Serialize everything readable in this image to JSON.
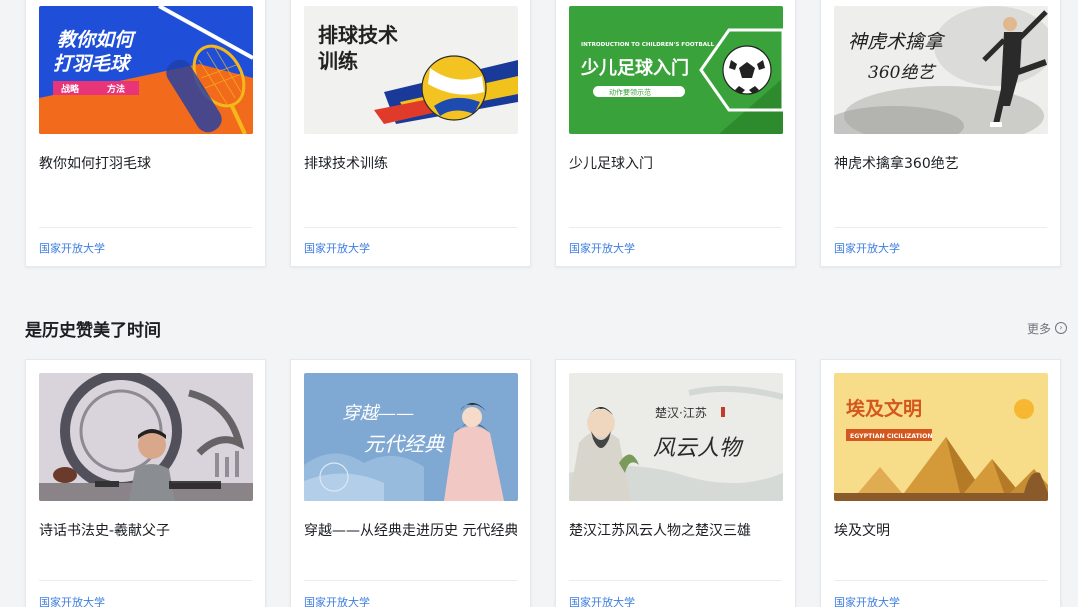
{
  "top_courses": [
    {
      "title": "教你如何打羽毛球",
      "provider": "国家开放大学",
      "thumb_lines": [
        "教你如何",
        "打羽毛球"
      ],
      "thumb_tags": [
        "战略",
        "方法"
      ]
    },
    {
      "title": "排球技术训练",
      "provider": "国家开放大学",
      "thumb_lines": [
        "排球技术",
        "训练"
      ]
    },
    {
      "title": "少儿足球入门",
      "provider": "国家开放大学",
      "thumb_caption": "INTRODUCTION TO CHILDREN'S FOOTBALL",
      "thumb_lines": [
        "少儿足球入门"
      ],
      "thumb_sub": "动作要领示范"
    },
    {
      "title": "神虎术擒拿360绝艺",
      "provider": "国家开放大学",
      "thumb_lines": [
        "神虎术擒拿",
        "360绝艺"
      ]
    }
  ],
  "section": {
    "title": "是历史赞美了时间",
    "more_label": "更多"
  },
  "bottom_courses": [
    {
      "title": "诗话书法史-羲献父子",
      "provider": "国家开放大学"
    },
    {
      "title": "穿越——从经典走进历史 元代经典",
      "provider": "国家开放大学",
      "thumb_lines": [
        "穿越——",
        "元代经典"
      ]
    },
    {
      "title": "楚汉江苏风云人物之楚汉三雄",
      "provider": "国家开放大学",
      "thumb_lines": [
        "楚汉·江苏",
        "风云人物"
      ]
    },
    {
      "title": "埃及文明",
      "provider": "国家开放大学",
      "thumb_lines": [
        "埃及文明"
      ],
      "thumb_caption": "EGYPTIAN CICILIZATION"
    }
  ]
}
